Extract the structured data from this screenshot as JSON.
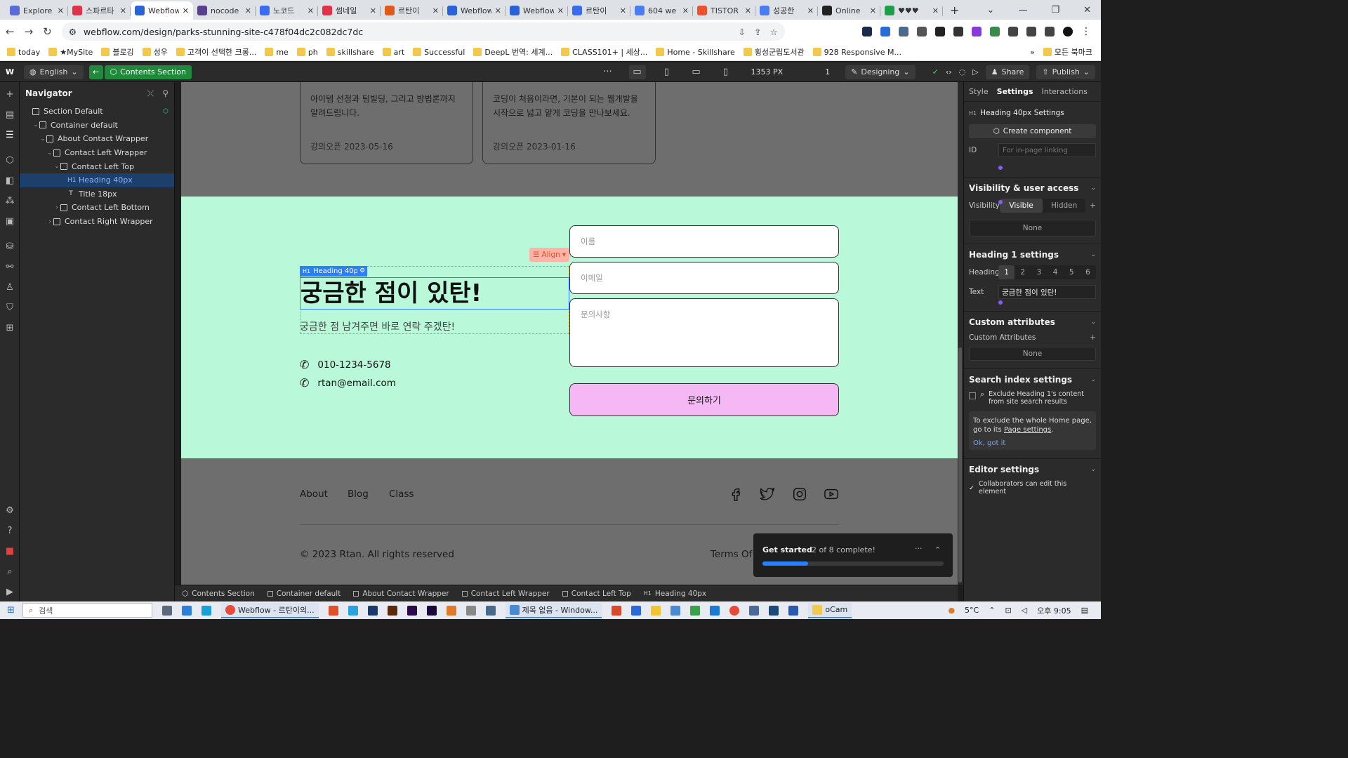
{
  "browser": {
    "tabs": [
      {
        "title": "Explore",
        "color": "#5b6bd8"
      },
      {
        "title": "스파르타",
        "color": "#e0324b"
      },
      {
        "title": "Webflow",
        "color": "#2a63d8",
        "active": true
      },
      {
        "title": "nocode",
        "color": "#5a3e8f"
      },
      {
        "title": "노코드",
        "color": "#3a6bf0"
      },
      {
        "title": "썸네일",
        "color": "#e0324b"
      },
      {
        "title": "르탄이",
        "color": "#e05a1c"
      },
      {
        "title": "Webflow",
        "color": "#2a63d8"
      },
      {
        "title": "Webflow",
        "color": "#2a63d8"
      },
      {
        "title": "르탄이",
        "color": "#3a6bf0"
      },
      {
        "title": "604 we",
        "color": "#4a7df0"
      },
      {
        "title": "TISTOR",
        "color": "#eb5230"
      },
      {
        "title": "성공한",
        "color": "#4a7df0"
      },
      {
        "title": "Online",
        "color": "#222222"
      },
      {
        "title": "♥♥♥",
        "color": "#1e9e4a"
      }
    ],
    "new_tab": "+",
    "url": "webflow.com/design/parks-stunning-site-c478f04dc2c082dc7dc",
    "bookmarks": [
      "today",
      "★MySite",
      "블로깅",
      "성우",
      "고객이 선택한 크롱...",
      "me",
      "ph",
      "skillshare",
      "art",
      "Successful",
      "DeepL 번역: 세계...",
      "CLASS101+ | 세상...",
      "Home - Skillshare",
      "횡성군립도서관",
      "928 Responsive M...",
      "모든 북마크"
    ],
    "more": "»"
  },
  "topbar": {
    "language": "English",
    "selected_element": "Contents Section",
    "width_readout": "1353 PX",
    "comment_count": "1",
    "mode": "Designing",
    "share": "Share",
    "publish": "Publish",
    "more": "···"
  },
  "navigator": {
    "title": "Navigator",
    "tree": [
      {
        "label": "Section Default",
        "depth": 0,
        "caret": "",
        "kind": "box"
      },
      {
        "label": "Container default",
        "depth": 1,
        "caret": "⌄",
        "kind": "box"
      },
      {
        "label": "About Contact Wrapper",
        "depth": 2,
        "caret": "⌄",
        "kind": "box"
      },
      {
        "label": "Contact Left Wrapper",
        "depth": 3,
        "caret": "⌄",
        "kind": "box"
      },
      {
        "label": "Contact Left Top",
        "depth": 4,
        "caret": "⌄",
        "kind": "box"
      },
      {
        "label": "Heading 40px",
        "depth": 5,
        "caret": "",
        "kind": "H1",
        "selected": true
      },
      {
        "label": "Title 18px",
        "depth": 5,
        "caret": "",
        "kind": "T"
      },
      {
        "label": "Contact Left Bottom",
        "depth": 4,
        "caret": "›",
        "kind": "box"
      },
      {
        "label": "Contact Right Wrapper",
        "depth": 3,
        "caret": "›",
        "kind": "box"
      }
    ]
  },
  "canvas": {
    "cards": [
      {
        "text": "아이템 선정과 팀빌딩, 그리고 방법론까지 알려드립니다.",
        "date": "강의오픈 2023-05-16"
      },
      {
        "text": "코딩이 처음이라면, 기본이 되는 웹개발을 시작으로 넓고 얕게 코딩을 만나보세요.",
        "date": "강의오픈 2023-01-16"
      }
    ],
    "heading_tag": "Heading 40px",
    "align_label": "Align",
    "heading": "궁금한 점이 있탄!",
    "subtitle": "궁금한 점 남겨주면 바로 연락 주겠탄!",
    "phone": "010-1234-5678",
    "email": "rtan@email.com",
    "form": {
      "name_placeholder": "이름",
      "email_placeholder": "이메일",
      "message_placeholder": "문의사항",
      "submit": "문의하기"
    },
    "footer": {
      "links": [
        "About",
        "Blog",
        "Class"
      ],
      "social": [
        "facebook-icon",
        "twitter-icon",
        "instagram-icon",
        "youtube-icon"
      ],
      "copyright": "© 2023 Rtan. All rights reserved",
      "terms": "Terms Of U"
    },
    "section_color": "#b9f8d9",
    "button_color": "#f5b8f5"
  },
  "get_started": {
    "title": "Get started",
    "progress_text": "2 of 8 complete!",
    "progress_fraction": 0.25,
    "more": "···",
    "collapse": "⌃"
  },
  "breadcrumbs": [
    "Contents Section",
    "Container default",
    "About Contact Wrapper",
    "Contact Left Wrapper",
    "Contact Left Top",
    "Heading 40px"
  ],
  "right_panel": {
    "tabs": [
      "Style",
      "Settings",
      "Interactions"
    ],
    "active_tab": "Settings",
    "element_title": "Heading 40px Settings",
    "create_component": "Create component",
    "id_label": "ID",
    "id_placeholder": "For in-page linking",
    "visibility_section": "Visibility & user access",
    "visibility_label": "Visibility",
    "visible": "Visible",
    "hidden": "Hidden",
    "none1": "None",
    "heading_section": "Heading 1 settings",
    "heading_label": "Heading",
    "heading_levels": [
      "1",
      "2",
      "3",
      "4",
      "5",
      "6"
    ],
    "text_label": "Text",
    "text_value": "궁금한 점이 있탄!",
    "custom_section": "Custom attributes",
    "custom_label": "Custom Attributes",
    "none2": "None",
    "search_section": "Search index settings",
    "exclude_text": "Exclude Heading 1's content from site search results",
    "note_text": "To exclude the whole Home page, go to its",
    "note_link": "Page settings",
    "note_end": ".",
    "ok": "Ok, got it",
    "editor_section": "Editor settings",
    "collab": "Collaborators can edit this element"
  },
  "taskbar": {
    "search": "검색",
    "app1": "Webflow - 르탄이의...",
    "app2": "제목 없음 - Window...",
    "app3": "oCam",
    "weather": "5°C",
    "time": "오후 9:05"
  }
}
